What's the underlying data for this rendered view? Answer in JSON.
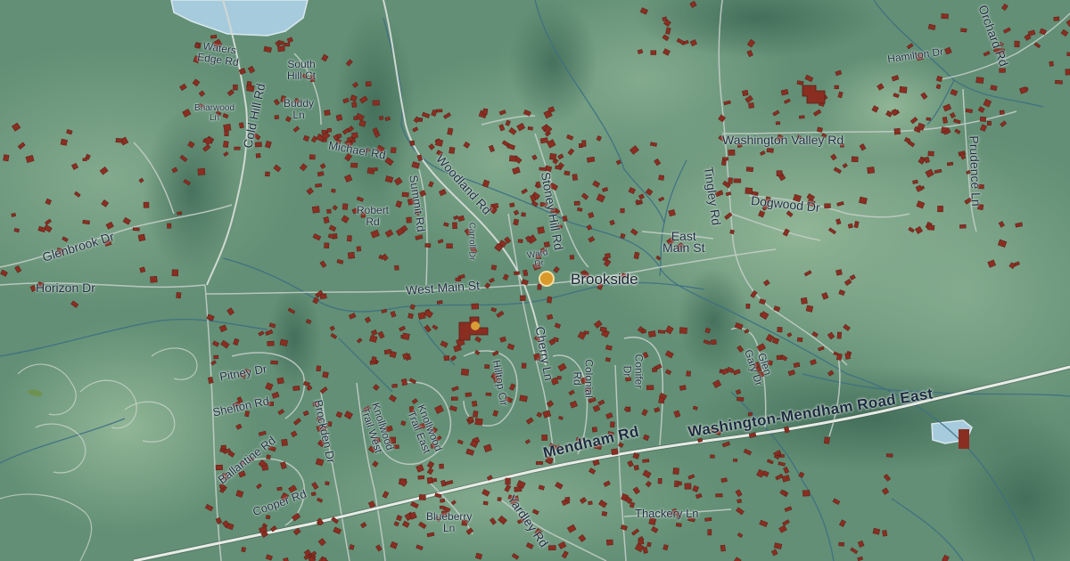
{
  "map": {
    "place": "Brookside",
    "roads": {
      "washington_mendham": "Washington-Mendham Road East",
      "mendham": "Mendham Rd",
      "west_main": "West Main St",
      "east_main": "East\nMain St",
      "woodland": "Woodland Rd",
      "stoney_hill": "Stoney Hill Rd",
      "washington_valley": "Washington Valley Rd",
      "tingley": "Tingley Rd",
      "dogwood": "Dogwood Dr",
      "prudence": "Prudence Ln",
      "hamilton": "Hamilton Dr",
      "orchard": "Orchard Rd",
      "cold_hill": "Cold Hill Rd",
      "waters_edge": "Waters\nEdge Rd",
      "south_hill": "South\nHill Ct",
      "briarwood": "Briarwood\nLn",
      "buddy": "Buddy\nLn",
      "michael": "Michael Rd",
      "summit": "Summit Rd",
      "robert": "Robert\nRd",
      "carroll": "Carroll Dr",
      "ward": "Ward\nDr",
      "glenbrook": "Glenbrook Dr",
      "horizon": "Horizon Dr",
      "pitney": "Pitney Dr",
      "shelton": "Shelton Rd",
      "ballantine": "Ballantine Rd",
      "cooper": "Cooper Rd",
      "brockden": "Brockden Dr",
      "knollwood_west": "Knollwood\nTrail West",
      "knollwood_east": "Knollwood\nTrail East",
      "hilltop": "Hilltop Cir",
      "cherry": "Cherry Ln",
      "colonial": "Colonial\nRd",
      "conifer": "Conifer\nDr",
      "glen_gary": "Glen\nGary Dr",
      "blueberry": "Blueberry\nLn",
      "yardley": "Yardley Rd",
      "thackery": "Thackery Ln"
    },
    "colors": {
      "terrain": "#5f8c73",
      "ridge": "#7aa388",
      "valley": "#4c7560",
      "water": "#9fc7dc",
      "stream": "#3f6f83",
      "building": "#8a2e22",
      "road": "#c6cfc9",
      "highway": "#e6e9e4",
      "label": "#1d2b3f"
    }
  }
}
